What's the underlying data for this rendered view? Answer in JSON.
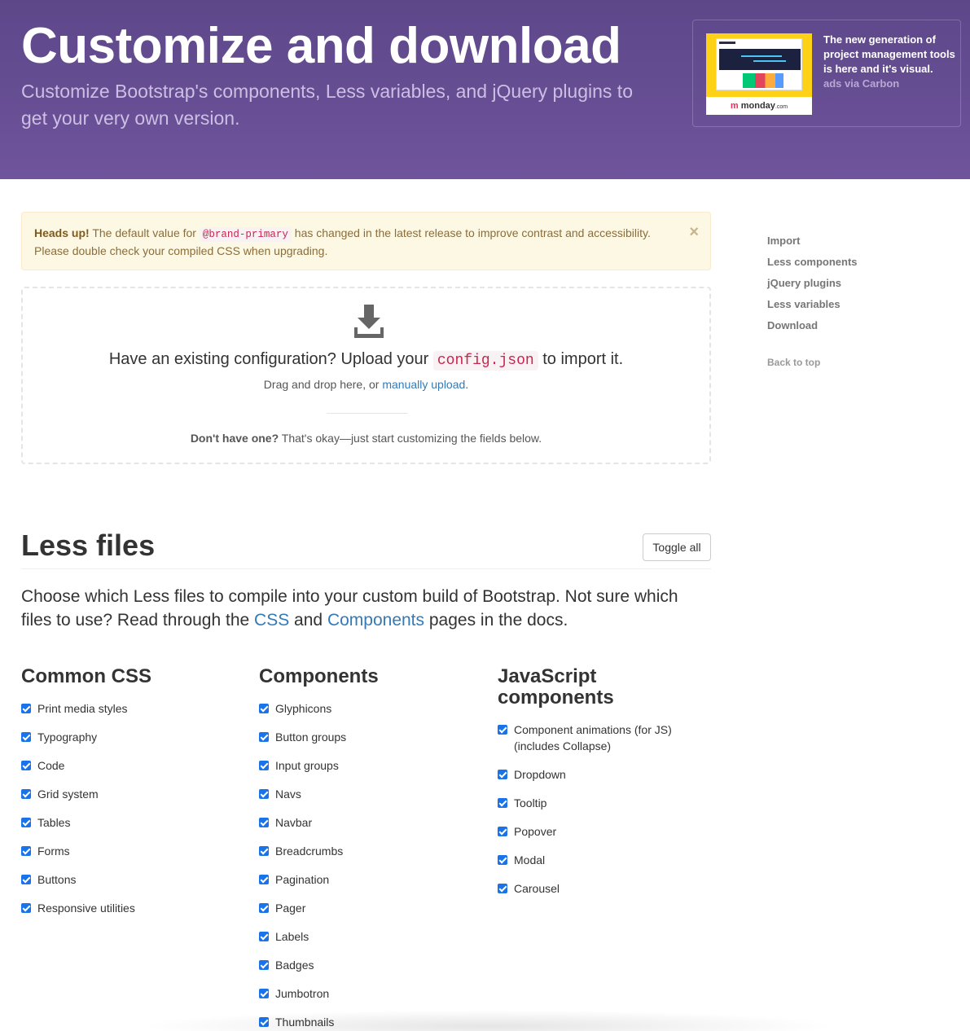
{
  "hero": {
    "title": "Customize and download",
    "subtitle": "Customize Bootstrap's components, Less variables, and jQuery plugins to get your very own version."
  },
  "ad": {
    "text": "The new generation of project management tools is here and it's visual.",
    "via": "ads via Carbon",
    "brand_mark": "m",
    "brand_name": "monday",
    "brand_suffix": ".com"
  },
  "alert": {
    "strong": "Heads up!",
    "text_before": " The default value for ",
    "code": "@brand-primary",
    "text_after": " has changed in the latest release to improve contrast and accessibility. Please double check your compiled CSS when upgrading.",
    "close": "×"
  },
  "import": {
    "heading_before": "Have an existing configuration? Upload your ",
    "heading_code": "config.json",
    "heading_after": " to import it.",
    "drag_before": "Drag and drop here, or ",
    "drag_link": "manually upload",
    "drag_after": ".",
    "none_strong": "Don't have one?",
    "none_text": " That's okay—just start customizing the fields below."
  },
  "sidenav": {
    "items": [
      "Import",
      "Less components",
      "jQuery plugins",
      "Less variables",
      "Download"
    ],
    "back_to_top": "Back to top"
  },
  "less": {
    "title": "Less files",
    "toggle_all": "Toggle all",
    "lead_before": "Choose which Less files to compile into your custom build of Bootstrap. Not sure which files to use? Read through the ",
    "lead_link1": "CSS",
    "lead_mid": " and ",
    "lead_link2": "Components",
    "lead_after": " pages in the docs."
  },
  "columns": [
    {
      "title": "Common CSS",
      "items": [
        "Print media styles",
        "Typography",
        "Code",
        "Grid system",
        "Tables",
        "Forms",
        "Buttons",
        "Responsive utilities"
      ]
    },
    {
      "title": "Components",
      "items": [
        "Glyphicons",
        "Button groups",
        "Input groups",
        "Navs",
        "Navbar",
        "Breadcrumbs",
        "Pagination",
        "Pager",
        "Labels",
        "Badges",
        "Jumbotron",
        "Thumbnails"
      ]
    },
    {
      "title": "JavaScript components",
      "items": [
        "Component animations (for JS) (includes Collapse)",
        "Dropdown",
        "Tooltip",
        "Popover",
        "Modal",
        "Carousel"
      ]
    }
  ]
}
